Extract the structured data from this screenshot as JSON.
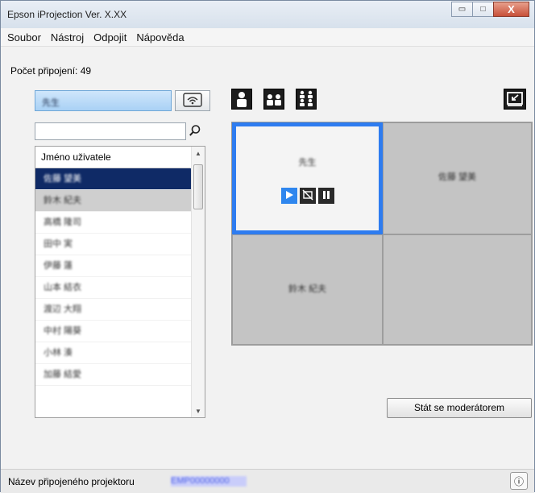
{
  "window": {
    "title": "Epson iProjection Ver. X.XX",
    "minimize_glyph": "▭",
    "maximize_glyph": "□",
    "close_glyph": "X"
  },
  "menu": [
    "Soubor",
    "Nástroj",
    "Odpojit",
    "Nápověda"
  ],
  "connections_label": "Počet připojení: 49",
  "selected_user": "先生",
  "search": {
    "value": "",
    "placeholder": ""
  },
  "user_list": {
    "header": "Jméno uživatele",
    "rows": [
      "佐藤 望美",
      "鈴木 紀夫",
      "高橋 隆司",
      "田中 実",
      "伊藤 蓮",
      "山本 結衣",
      "渡辺 大翔",
      "中村 陽葵",
      "小林 湊",
      "加藤 結愛"
    ],
    "selected_index": 0,
    "highlighted_index": 1,
    "scroll_up_glyph": "▲",
    "scroll_down_glyph": "▼"
  },
  "projection_panels": [
    {
      "name": "先生",
      "active": true
    },
    {
      "name": "佐藤 望美",
      "active": false
    },
    {
      "name": "鈴木 紀夫",
      "active": false
    },
    {
      "name": "",
      "active": false
    }
  ],
  "moderator_button": "Stát se moderátorem",
  "status": {
    "label": "Název připojeného projektoru",
    "projector_name": "EMP00000000",
    "info_glyph": "ⓘ"
  },
  "icons": {
    "search": "search-icon",
    "wifi": "wifi-projector-icon",
    "layout1": "layout-single-user-icon",
    "layout2": "layout-two-users-icon",
    "layout4": "layout-four-users-icon",
    "screen": "screen-preview-icon",
    "play": "play-icon",
    "stop": "stop-icon",
    "pause": "pause-icon",
    "info": "info-icon"
  },
  "colors": {
    "active_panel_border": "#2e7cf0",
    "selected_row": "#0f2a66",
    "play_button": "#2e86ee"
  }
}
